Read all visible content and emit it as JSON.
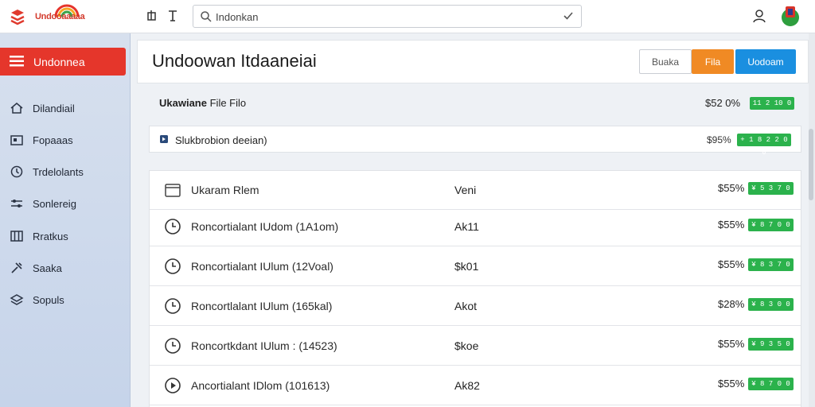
{
  "app": {
    "logo_text": "Undooaaaaa"
  },
  "search": {
    "value": "Indonkan",
    "placeholder": ""
  },
  "sidebar": {
    "active_label": "Undonnea",
    "items": [
      {
        "label": "Dilandiail",
        "icon": "home-icon"
      },
      {
        "label": "Fopaaas",
        "icon": "folder-icon"
      },
      {
        "label": "Trdelolants",
        "icon": "clock-icon"
      },
      {
        "label": "Sonlereig",
        "icon": "settings-icon"
      },
      {
        "label": "Rratkus",
        "icon": "grid-icon"
      },
      {
        "label": "Saaka",
        "icon": "tool-icon"
      },
      {
        "label": "Sopuls",
        "icon": "layers-icon"
      }
    ]
  },
  "header": {
    "title": "Undoowan Itdaaneiai",
    "buttons": [
      "Buaka",
      "Fila",
      "Uodoam"
    ]
  },
  "summary": {
    "label_bold": "Ukawiane",
    "label_rest": "File Filo",
    "value": "$52 0%",
    "badge": "11 2 10 0"
  },
  "subrow": {
    "label": "Slukbrobion deeian)",
    "value": "$95%",
    "badge": "+ 1 8 2 2 0 0"
  },
  "table": {
    "header": {
      "name": "Ukaram Rlem",
      "mid": "Veni",
      "pct": "$55%",
      "badge": "¥ 5 3 7 0 0"
    },
    "rows": [
      {
        "name": "Roncortialant IUdom (1A1om)",
        "mid": "Ak11",
        "pct": "$55%",
        "badge": "¥ 8 7 0 0",
        "icon": "clock-icon"
      },
      {
        "name": "Roncortialant IUlum (12Voal)",
        "mid": "$k01",
        "pct": "$55%",
        "badge": "¥ 8 3 7 0 0",
        "icon": "clock-icon"
      },
      {
        "name": "Roncortlalant IUlum (165kal)",
        "mid": "Akot",
        "pct": "$28%",
        "badge": "¥ 8 3 0 0 0",
        "icon": "clock-icon"
      },
      {
        "name": "Roncortkdant IUlum : (14523)",
        "mid": "$koe",
        "pct": "$55%",
        "badge": "¥ 9 3 5 0 0",
        "icon": "clock-icon"
      },
      {
        "name": "Ancortialant IDlom (101613)",
        "mid": "Ak82",
        "pct": "$55%",
        "badge": "¥ 8 7 0 0 0",
        "icon": "play-icon"
      }
    ]
  },
  "colors": {
    "accent_red": "#e5362b",
    "accent_orange": "#f08a24",
    "accent_blue": "#1a8fe0",
    "badge_green": "#2bb24c"
  }
}
